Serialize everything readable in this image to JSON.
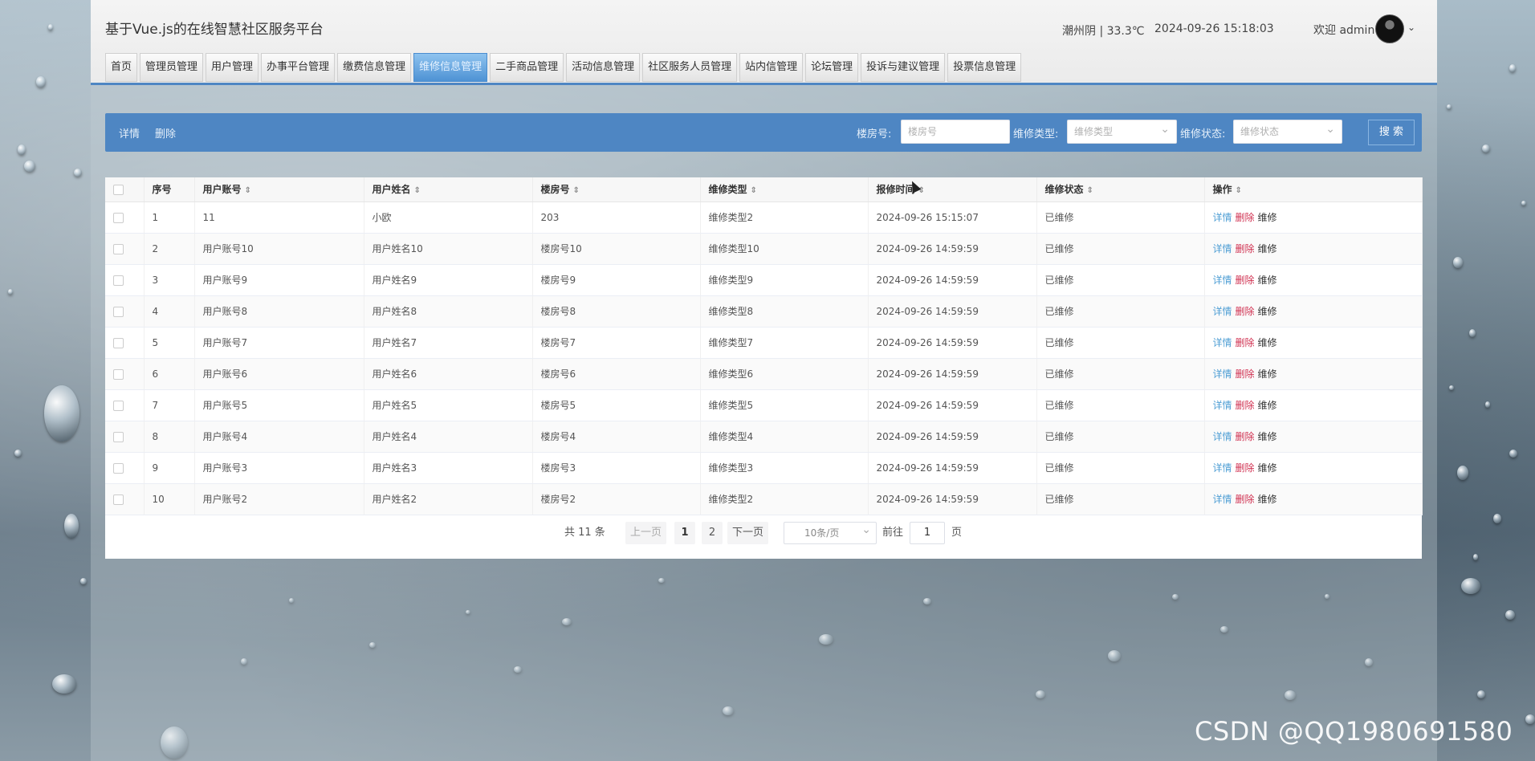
{
  "header": {
    "site_title": "基于Vue.js的在线智慧社区服务平台",
    "weather": "潮州阴 | 33.3℃",
    "datetime": "2024-09-26  15:18:03",
    "welcome": "欢迎 admin"
  },
  "nav": {
    "items": [
      {
        "label": "首页"
      },
      {
        "label": "管理员管理"
      },
      {
        "label": "用户管理"
      },
      {
        "label": "办事平台管理"
      },
      {
        "label": "缴费信息管理"
      },
      {
        "label": "维修信息管理",
        "active": true
      },
      {
        "label": "二手商品管理"
      },
      {
        "label": "活动信息管理"
      },
      {
        "label": "社区服务人员管理"
      },
      {
        "label": "站内信管理"
      },
      {
        "label": "论坛管理"
      },
      {
        "label": "投诉与建议管理"
      },
      {
        "label": "投票信息管理"
      }
    ]
  },
  "toolbar": {
    "detail_label": "详情",
    "delete_label": "删除",
    "room_label": "楼房号:",
    "room_placeholder": "楼房号",
    "type_label": "维修类型:",
    "type_placeholder": "维修类型",
    "status_label": "维修状态:",
    "status_placeholder": "维修状态",
    "search_label": "搜 索"
  },
  "table": {
    "headers": [
      "序号",
      "用户账号",
      "用户姓名",
      "楼房号",
      "维修类型",
      "报修时间",
      "维修状态",
      "操作"
    ],
    "rows": [
      [
        "1",
        "11",
        "小欧",
        "203",
        "维修类型2",
        "2024-09-26 15:15:07",
        "已维修"
      ],
      [
        "2",
        "用户账号10",
        "用户姓名10",
        "楼房号10",
        "维修类型10",
        "2024-09-26 14:59:59",
        "已维修"
      ],
      [
        "3",
        "用户账号9",
        "用户姓名9",
        "楼房号9",
        "维修类型9",
        "2024-09-26 14:59:59",
        "已维修"
      ],
      [
        "4",
        "用户账号8",
        "用户姓名8",
        "楼房号8",
        "维修类型8",
        "2024-09-26 14:59:59",
        "已维修"
      ],
      [
        "5",
        "用户账号7",
        "用户姓名7",
        "楼房号7",
        "维修类型7",
        "2024-09-26 14:59:59",
        "已维修"
      ],
      [
        "6",
        "用户账号6",
        "用户姓名6",
        "楼房号6",
        "维修类型6",
        "2024-09-26 14:59:59",
        "已维修"
      ],
      [
        "7",
        "用户账号5",
        "用户姓名5",
        "楼房号5",
        "维修类型5",
        "2024-09-26 14:59:59",
        "已维修"
      ],
      [
        "8",
        "用户账号4",
        "用户姓名4",
        "楼房号4",
        "维修类型4",
        "2024-09-26 14:59:59",
        "已维修"
      ],
      [
        "9",
        "用户账号3",
        "用户姓名3",
        "楼房号3",
        "维修类型3",
        "2024-09-26 14:59:59",
        "已维修"
      ],
      [
        "10",
        "用户账号2",
        "用户姓名2",
        "楼房号2",
        "维修类型2",
        "2024-09-26 14:59:59",
        "已维修"
      ]
    ],
    "actions": {
      "detail": "详情",
      "delete": "删除",
      "repair": "维修"
    }
  },
  "pagination": {
    "total": "共 11 条",
    "prev": "上一页",
    "pages": [
      "1",
      "2"
    ],
    "current": "1",
    "next": "下一页",
    "page_size": "10条/页",
    "goto_label": "前往",
    "goto_value": "1",
    "page_suffix": "页"
  },
  "watermark": "CSDN @QQ1980691580",
  "colors": {
    "accent": "#4e86c3",
    "active_tab": "#4e92d4",
    "delete": "#d03050",
    "detail": "#4e9ed4"
  }
}
